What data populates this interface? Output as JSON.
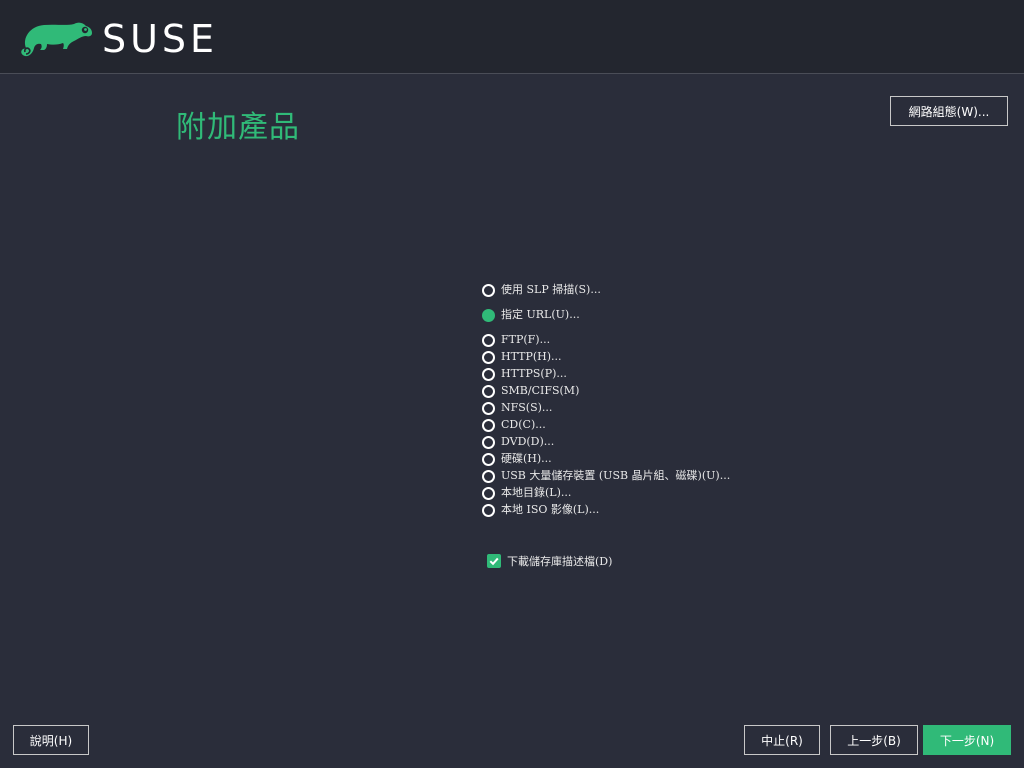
{
  "header": {
    "brand": "SUSE",
    "brand_color": "#30ba78"
  },
  "page": {
    "title": "附加產品"
  },
  "buttons": {
    "network_config": "網路組態(W)...",
    "help": "說明(H)",
    "abort": "中止(R)",
    "back": "上一步(B)",
    "next": "下一步(N)"
  },
  "options": {
    "selected": "指定 URL(U)...",
    "items": [
      "使用 SLP 掃描(S)...",
      "指定 URL(U)...",
      "FTP(F)...",
      "HTTP(H)...",
      "HTTPS(P)...",
      "SMB/CIFS(M)",
      "NFS(S)...",
      "CD(C)...",
      "DVD(D)...",
      "硬碟(H)...",
      "USB 大量儲存裝置 (USB 晶片組、磁碟)(U)...",
      "本地目錄(L)...",
      "本地 ISO 影像(L)..."
    ]
  },
  "download_descriptions": {
    "label": "下載儲存庫描述檔(D)",
    "checked": true
  }
}
